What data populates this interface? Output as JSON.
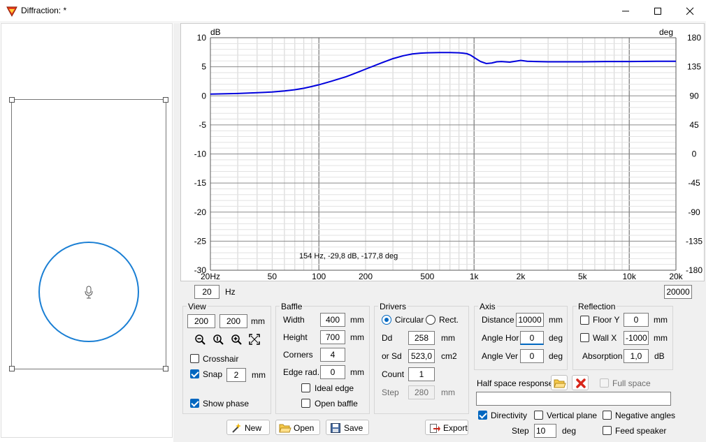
{
  "window": {
    "title": "Diffraction: *"
  },
  "chart_data": {
    "type": "line",
    "ylabel_left": "dB",
    "ylabel_right": "deg",
    "xscale": "log",
    "xlim": [
      20,
      20000
    ],
    "ylim": [
      -30,
      10
    ],
    "ylim_right": [
      -180,
      180
    ],
    "x_tick_labels": [
      "20Hz",
      "50",
      "100",
      "200",
      "500",
      "1k",
      "2k",
      "5k",
      "10k",
      "20k"
    ],
    "y_tick_labels": [
      "10",
      "5",
      "0",
      "-5",
      "-10",
      "-15",
      "-20",
      "-25",
      "-30"
    ],
    "y2_tick_labels": [
      "180",
      "135",
      "90",
      "45",
      "0",
      "-45",
      "-90",
      "-135",
      "-180"
    ],
    "grid": true,
    "cursor_readout": "154 Hz, -29,8 dB, -177,8 deg",
    "series": [
      {
        "color": "#0000dd",
        "x": [
          20,
          30,
          40,
          50,
          60,
          70,
          80,
          90,
          100,
          120,
          150,
          180,
          200,
          250,
          300,
          350,
          400,
          450,
          500,
          600,
          700,
          800,
          850,
          900,
          950,
          1000,
          1100,
          1200,
          1300,
          1400,
          1500,
          1700,
          1800,
          2000,
          2200,
          2500,
          3000,
          4000,
          5000,
          7000,
          10000,
          15000,
          20000
        ],
        "y": [
          0.3,
          0.4,
          0.55,
          0.65,
          0.85,
          1.05,
          1.3,
          1.6,
          1.9,
          2.5,
          3.3,
          4.1,
          4.6,
          5.6,
          6.4,
          6.9,
          7.2,
          7.35,
          7.4,
          7.45,
          7.45,
          7.4,
          7.35,
          7.25,
          7.0,
          6.6,
          5.9,
          5.55,
          5.65,
          5.85,
          5.9,
          5.8,
          5.9,
          6.1,
          5.95,
          5.9,
          5.85,
          5.85,
          5.85,
          5.9,
          5.9,
          5.95,
          5.95
        ]
      }
    ]
  },
  "freq_range": {
    "low": "20",
    "unit": "Hz",
    "high": "20000"
  },
  "view": {
    "title": "View",
    "width": "200",
    "height": "200",
    "unit": "mm",
    "zoom_icons": [
      "zoom-out-icon",
      "zoom-height-icon",
      "zoom-in-icon",
      "zoom-fit-icon"
    ],
    "crosshair_label": "Crosshair",
    "crosshair": false,
    "snap_label": "Snap",
    "snap": true,
    "snap_value": "2",
    "snap_unit": "mm",
    "show_phase_label": "Show phase",
    "show_phase": true
  },
  "baffle": {
    "title": "Baffle",
    "width_label": "Width",
    "width": "400",
    "width_unit": "mm",
    "height_label": "Height",
    "height": "700",
    "height_unit": "mm",
    "corners_label": "Corners",
    "corners": "4",
    "edge_label": "Edge rad.",
    "edge": "0",
    "edge_unit": "mm",
    "ideal_edge_label": "Ideal edge",
    "ideal_edge": false,
    "open_baffle_label": "Open baffle",
    "open_baffle": false
  },
  "drivers": {
    "title": "Drivers",
    "circular_label": "Circular",
    "circular": true,
    "rect_label": "Rect.",
    "dd_label": "Dd",
    "dd": "258",
    "dd_unit": "mm",
    "sd_label": "or Sd",
    "sd": "523,0",
    "sd_unit": "cm2",
    "count_label": "Count",
    "count": "1",
    "step_label": "Step",
    "step": "280",
    "step_unit": "mm"
  },
  "axis": {
    "title": "Axis",
    "distance_label": "Distance",
    "distance": "10000",
    "distance_unit": "mm",
    "angle_hor_label": "Angle Hor",
    "angle_hor": "0",
    "angle_hor_unit": "deg",
    "angle_ver_label": "Angle Ver",
    "angle_ver": "0",
    "angle_ver_unit": "deg"
  },
  "reflection": {
    "title": "Reflection",
    "floor_label": "Floor Y",
    "floor": false,
    "floor_value": "0",
    "floor_unit": "mm",
    "wall_label": "Wall  X",
    "wall": false,
    "wall_value": "-1000",
    "wall_unit": "mm",
    "absorption_label": "Absorption",
    "absorption": "1,0",
    "absorption_unit": "dB"
  },
  "half_space": {
    "label": "Half space response",
    "full_space_label": "Full space",
    "full_space": false,
    "path": ""
  },
  "directivity": {
    "directivity_label": "Directivity",
    "directivity": true,
    "vertical_plane_label": "Vertical plane",
    "vertical_plane": false,
    "negative_angles_label": "Negative angles",
    "negative_angles": false,
    "step_label": "Step",
    "step": "10",
    "step_unit": "deg",
    "feed_speaker_label": "Feed speaker",
    "feed_speaker": false
  },
  "buttons": {
    "new": "New",
    "open": "Open",
    "save": "Save",
    "export": "Export"
  },
  "colors": {
    "accent": "#0067c0",
    "curve": "#0000dd",
    "driver_circle": "#1a7fd4"
  }
}
